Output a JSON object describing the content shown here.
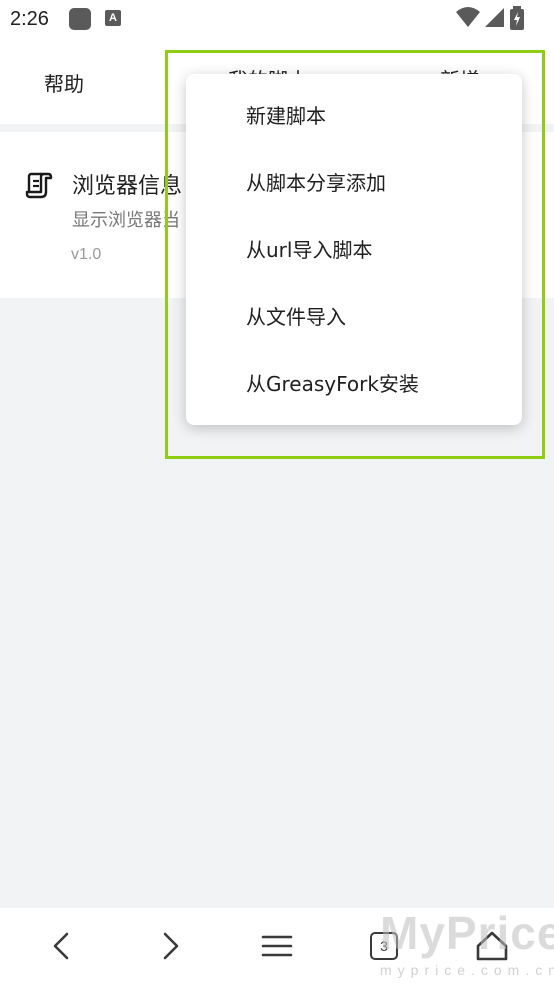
{
  "status_bar": {
    "time": "2:26",
    "a_icon_label": "A",
    "icons": [
      "app-icon",
      "a-icon",
      "wifi-icon",
      "signal-icon",
      "battery-charging-icon"
    ]
  },
  "tabs": {
    "help": "帮助",
    "my_scripts": "我的脚本",
    "new": "新增"
  },
  "script": {
    "name": "浏览器信息",
    "description": "显示浏览器当",
    "version": "v1.0"
  },
  "menu": {
    "items": [
      {
        "label": "新建脚本"
      },
      {
        "label": "从脚本分享添加"
      },
      {
        "label": "从url导入脚本"
      },
      {
        "label": "从文件导入"
      },
      {
        "label": "从GreasyFork安装"
      }
    ]
  },
  "bottom_nav": {
    "tab_count": "3",
    "icons": [
      "back-icon",
      "forward-icon",
      "menu-icon",
      "tabs-icon",
      "home-icon"
    ]
  },
  "watermark": {
    "text": "MyPrice",
    "subtext": "myprice.com.cn"
  },
  "colors": {
    "highlight": "#8fce12",
    "background": "#f2f3f5"
  }
}
